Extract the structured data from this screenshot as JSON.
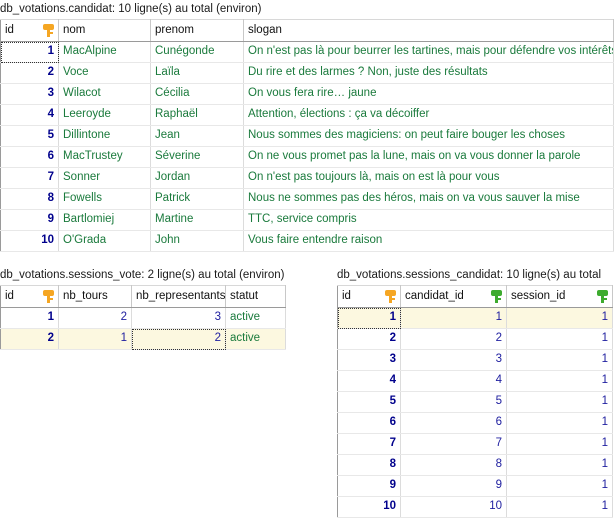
{
  "grids": [
    {
      "id": "candidat",
      "title": "db_votations.candidat: 10 ligne(s) au total (environ)",
      "columns": [
        {
          "label": "id",
          "key_icon": "primary-key-icon-orange",
          "align": "right"
        },
        {
          "label": "nom",
          "key_icon": null,
          "align": "left"
        },
        {
          "label": "prenom",
          "key_icon": null,
          "align": "left"
        },
        {
          "label": "slogan",
          "key_icon": null,
          "align": "left"
        }
      ],
      "rows": [
        {
          "id": "1",
          "nom": "MacAlpine",
          "prenom": "Cunégonde",
          "slogan": "On n'est pas là pour beurrer les tartines, mais pour défendre vos intérêts"
        },
        {
          "id": "2",
          "nom": "Voce",
          "prenom": "Laïla",
          "slogan": "Du rire et des larmes ? Non, juste des résultats"
        },
        {
          "id": "3",
          "nom": "Wilacot",
          "prenom": "Cécilia",
          "slogan": "On vous fera rire… jaune"
        },
        {
          "id": "4",
          "nom": "Leeroyde",
          "prenom": "Raphaël",
          "slogan": "Attention, élections : ça va décoiffer"
        },
        {
          "id": "5",
          "nom": "Dillintone",
          "prenom": "Jean",
          "slogan": "Nous sommes des magiciens: on peut faire bouger les choses"
        },
        {
          "id": "6",
          "nom": "MacTrustey",
          "prenom": "Séverine",
          "slogan": "On ne vous promet pas la lune, mais on va vous donner la parole"
        },
        {
          "id": "7",
          "nom": "Sonner",
          "prenom": "Jordan",
          "slogan": "On n'est pas toujours là, mais on est là pour vous"
        },
        {
          "id": "8",
          "nom": "Fowells",
          "prenom": "Patrick",
          "slogan": "Nous ne sommes pas des héros, mais on va vous sauver la mise"
        },
        {
          "id": "9",
          "nom": "Bartlomiej",
          "prenom": "Martine",
          "slogan": "TTC, service compris"
        },
        {
          "id": "10",
          "nom": "O'Grada",
          "prenom": "John",
          "slogan": "Vous faire entendre raison"
        }
      ]
    },
    {
      "id": "sessions_vote",
      "title": "db_votations.sessions_vote: 2 ligne(s) au total (environ)",
      "columns": [
        {
          "label": "id",
          "key_icon": "primary-key-icon-orange",
          "align": "right"
        },
        {
          "label": "nb_tours",
          "key_icon": null,
          "align": "right"
        },
        {
          "label": "nb_representants",
          "key_icon": null,
          "align": "right"
        },
        {
          "label": "statut",
          "key_icon": null,
          "align": "left"
        }
      ],
      "rows": [
        {
          "id": "1",
          "nb_tours": "2",
          "nb_representants": "3",
          "statut": "active"
        },
        {
          "id": "2",
          "nb_tours": "1",
          "nb_representants": "2",
          "statut": "active"
        }
      ]
    },
    {
      "id": "sessions_candidat",
      "title": "db_votations.sessions_candidat: 10 ligne(s) au total",
      "columns": [
        {
          "label": "id",
          "key_icon": "primary-key-icon-orange",
          "align": "right"
        },
        {
          "label": "candidat_id",
          "key_icon": "foreign-key-icon-green",
          "align": "right"
        },
        {
          "label": "session_id",
          "key_icon": "foreign-key-icon-green",
          "align": "right"
        }
      ],
      "rows": [
        {
          "id": "1",
          "candidat_id": "1",
          "session_id": "1"
        },
        {
          "id": "2",
          "candidat_id": "2",
          "session_id": "1"
        },
        {
          "id": "3",
          "candidat_id": "3",
          "session_id": "1"
        },
        {
          "id": "4",
          "candidat_id": "4",
          "session_id": "1"
        },
        {
          "id": "5",
          "candidat_id": "5",
          "session_id": "1"
        },
        {
          "id": "6",
          "candidat_id": "6",
          "session_id": "1"
        },
        {
          "id": "7",
          "candidat_id": "7",
          "session_id": "1"
        },
        {
          "id": "8",
          "candidat_id": "8",
          "session_id": "1"
        },
        {
          "id": "9",
          "candidat_id": "9",
          "session_id": "1"
        },
        {
          "id": "10",
          "candidat_id": "10",
          "session_id": "1"
        }
      ]
    }
  ],
  "colors": {
    "id_text": "#00008c",
    "number_text": "#2020a0",
    "string_text": "#1a7a3c",
    "selected_row": "#fcf8e0",
    "primary_key": "#f5a623",
    "foreign_key": "#3dab2e"
  }
}
